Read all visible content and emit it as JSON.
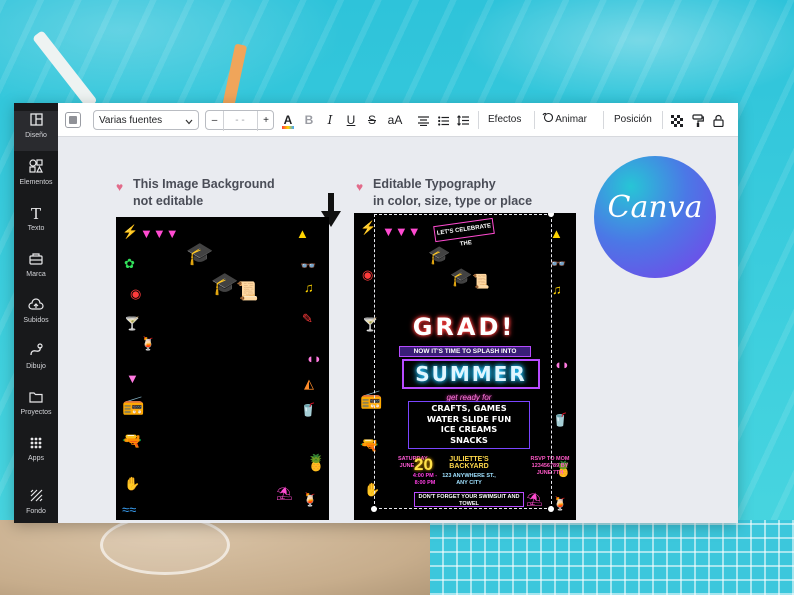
{
  "sidebar": {
    "items": [
      {
        "label": "Diseño",
        "icon": "layout-icon"
      },
      {
        "label": "Elementos",
        "icon": "shapes-icon"
      },
      {
        "label": "Texto",
        "icon": "text-icon"
      },
      {
        "label": "Marca",
        "icon": "brand-icon"
      },
      {
        "label": "Subidos",
        "icon": "upload-cloud-icon"
      },
      {
        "label": "Dibujo",
        "icon": "draw-icon"
      },
      {
        "label": "Proyectos",
        "icon": "folder-icon"
      },
      {
        "label": "Apps",
        "icon": "apps-grid-icon"
      },
      {
        "label": "Fondo",
        "icon": "background-pattern-icon"
      }
    ]
  },
  "toolbar": {
    "font_select": "Varias fuentes",
    "size_minus": "–",
    "size_value": "- -",
    "size_plus": "+",
    "text_color_glyph": "A",
    "bold_glyph": "B",
    "italic_glyph": "I",
    "underline_glyph": "U",
    "strike_glyph": "S",
    "case_glyph": "aA",
    "effects_label": "Efectos",
    "animate_label": "Animar",
    "position_label": "Posición"
  },
  "captions": {
    "left_line1": "This Image Background",
    "left_line2": "not editable",
    "right_line1": "Editable Typography",
    "right_line2": "in color, size, type or place"
  },
  "invitation": {
    "lets_celebrate": "LET'S CELEBRATE THE",
    "grad": "GRAD!",
    "splash_line": "NOW IT'S TIME TO SPLASH INTO",
    "summer": "SUMMER",
    "ready": "get ready for",
    "activities": [
      "CRAFTS, GAMES",
      "WATER SLIDE FUN",
      "ICE CREAMS",
      "SNACKS"
    ],
    "day_label": "SATURDAY JUNE",
    "date_number": "20",
    "time": "4:00 PM - 8:00 PM",
    "place_name": "JULIETTE'S BACKYARD",
    "place_address": "123 ANYWHERE ST., ANY CITY",
    "rsvp": "RSVP TO MOM 123456789 BY JUNE 7TH",
    "reminder": "DON'T FORGET YOUR SWIMSUIT AND TOWEL"
  },
  "logo": {
    "text": "Canva"
  },
  "colors": {
    "sidebar_bg": "#18191b",
    "canvas_bg": "#e9ebf0",
    "caption_text": "#4a4d57",
    "heart": "#e26b8a",
    "logo_gradient_start": "#27c5d6",
    "logo_gradient_end": "#7b3ee9"
  }
}
